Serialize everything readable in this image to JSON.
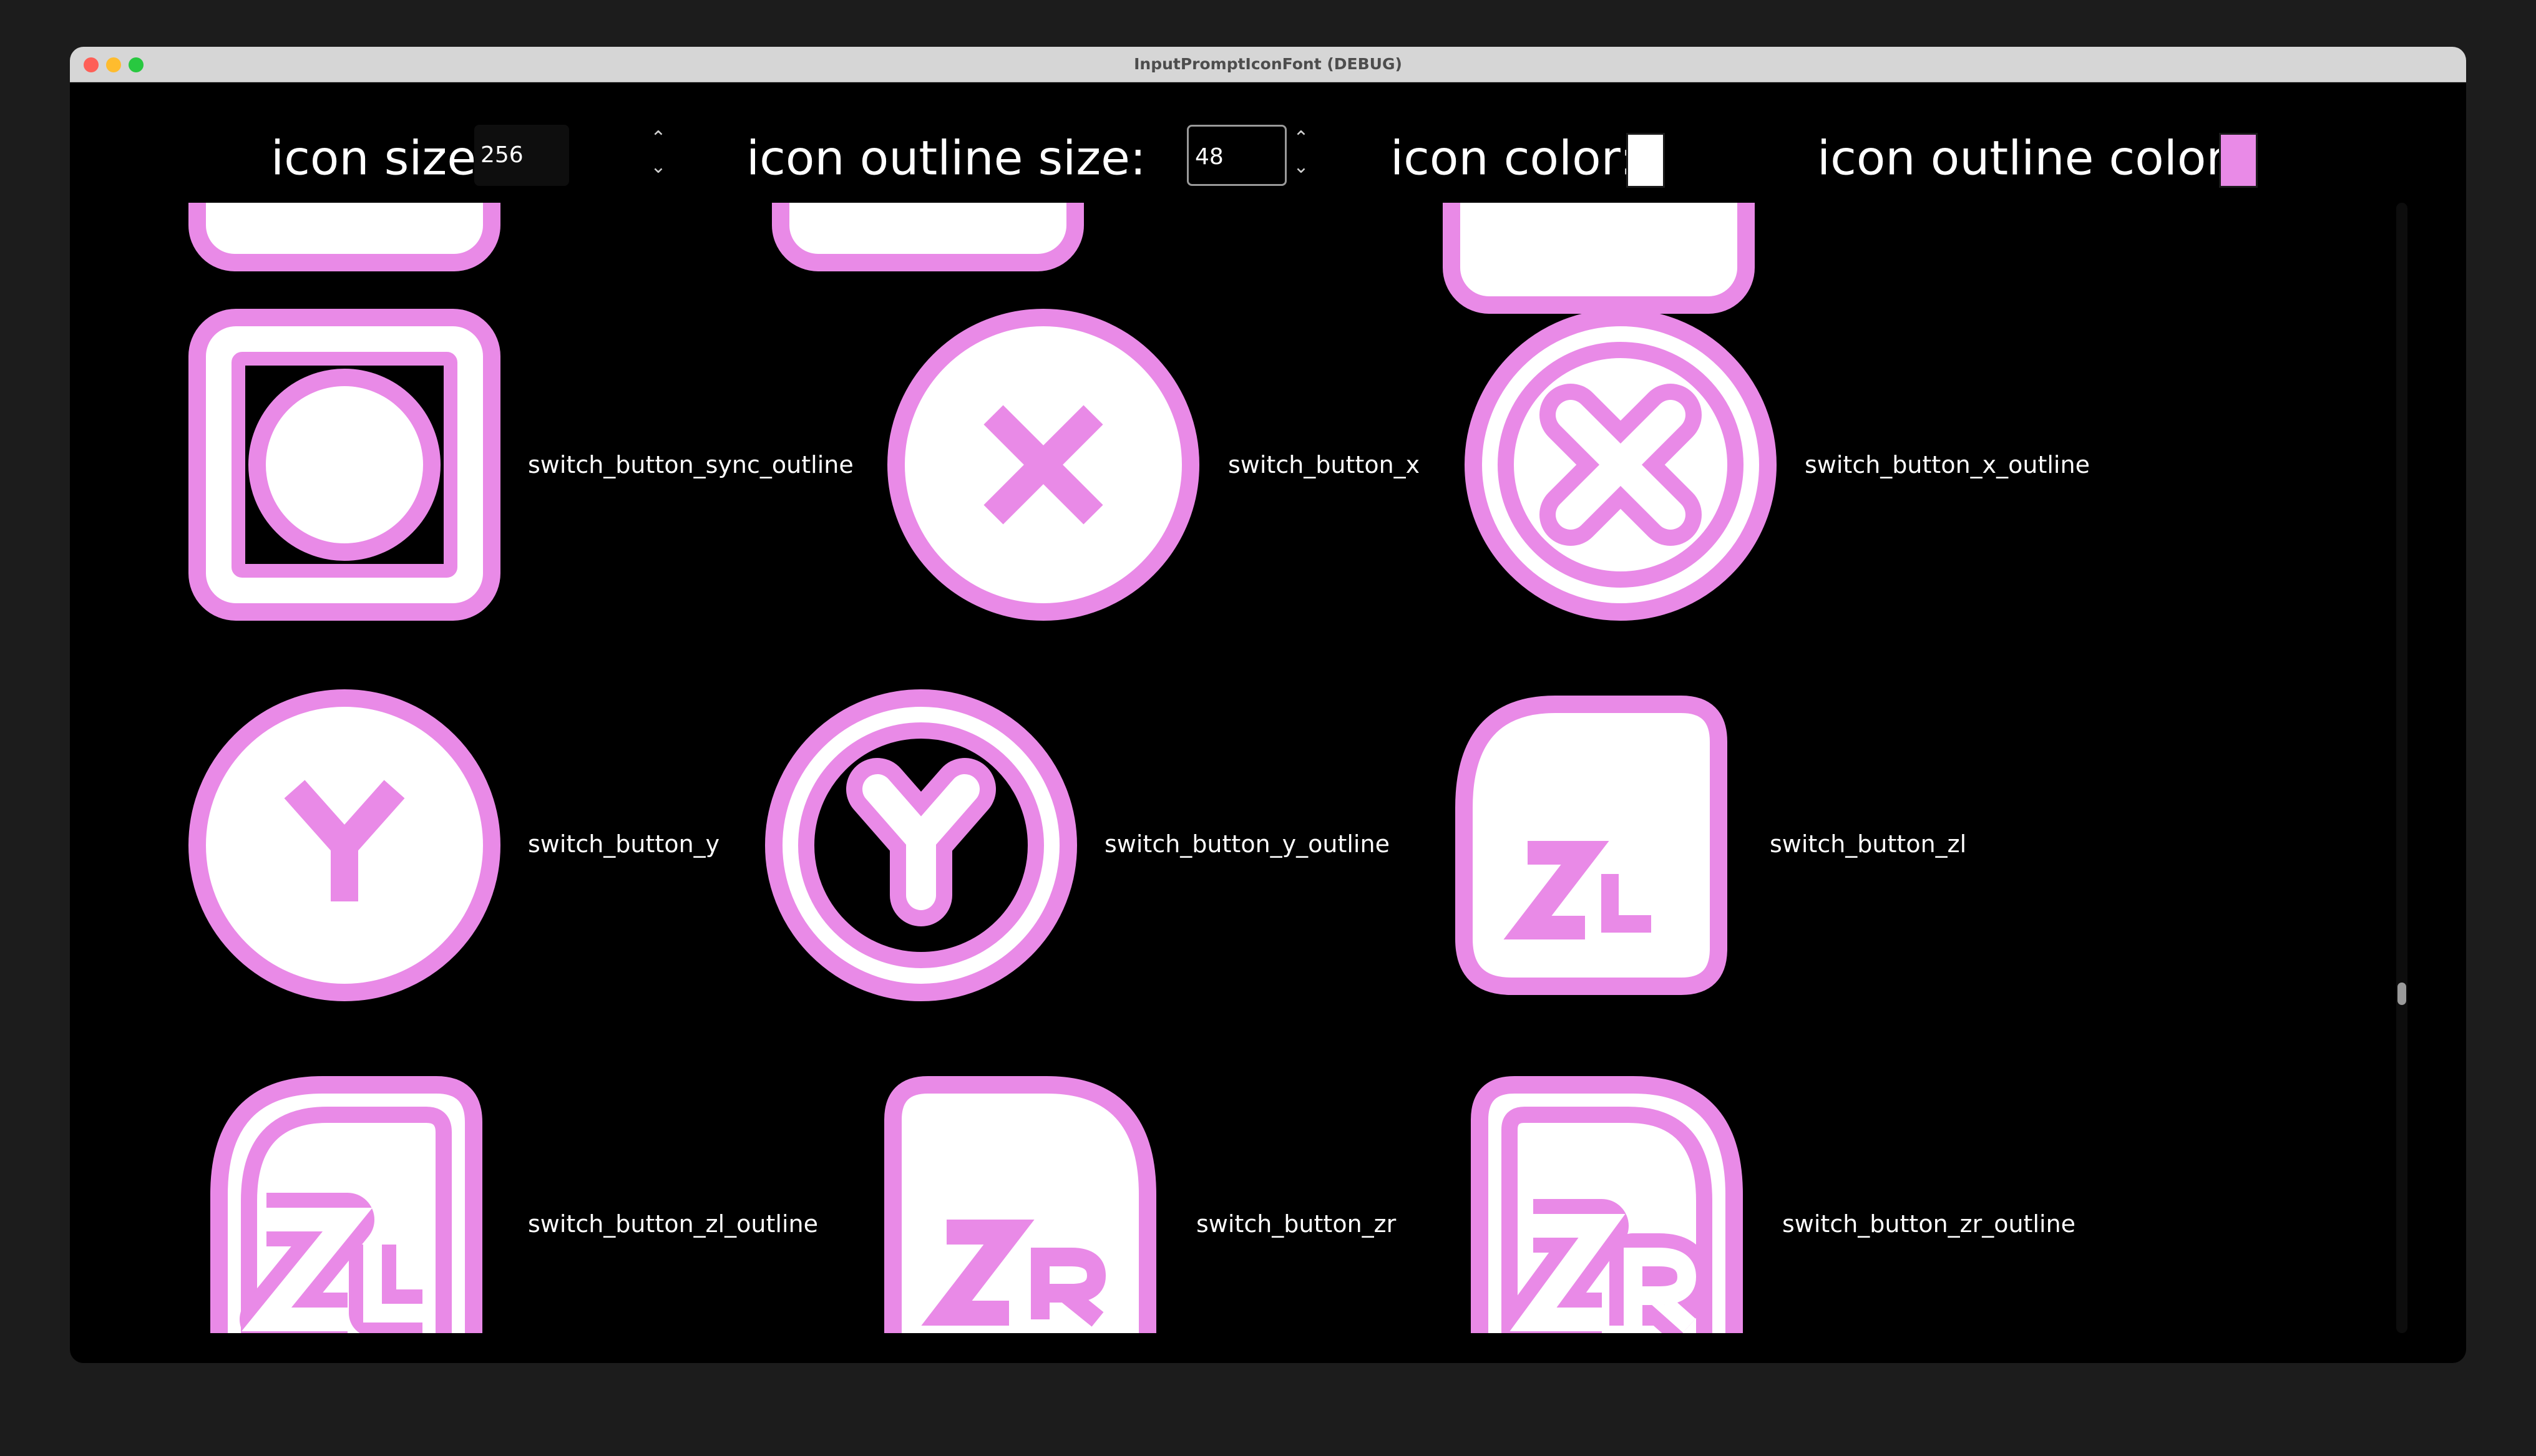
{
  "window": {
    "title": "InputPromptIconFont (DEBUG)"
  },
  "toolbar": {
    "icon_size_label": "icon size:",
    "icon_size_value": "256",
    "outline_size_label": "icon outline size:",
    "outline_size_value": "48",
    "icon_color_label": "icon color:",
    "icon_color_value": "#ffffff",
    "outline_color_label": "icon outline color:",
    "outline_color_value": "#e98ae7"
  },
  "colors": {
    "accent": "#e98ae7",
    "fill": "#ffffff",
    "background": "#000000"
  },
  "icons": [
    {
      "name": "switch_button_sync_outline"
    },
    {
      "name": "switch_button_x"
    },
    {
      "name": "switch_button_x_outline"
    },
    {
      "name": "switch_button_y"
    },
    {
      "name": "switch_button_y_outline"
    },
    {
      "name": "switch_button_zl"
    },
    {
      "name": "switch_button_zl_outline"
    },
    {
      "name": "switch_button_zr"
    },
    {
      "name": "switch_button_zr_outline"
    }
  ]
}
